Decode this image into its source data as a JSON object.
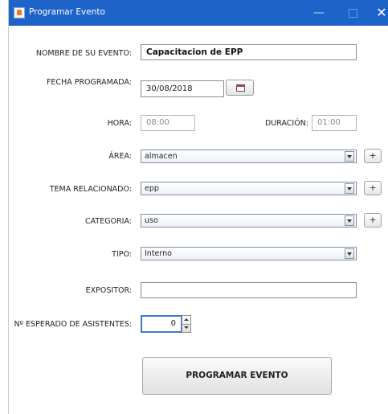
{
  "window": {
    "title": "Programar Evento",
    "minimize_glyph": "—",
    "close_glyph": "✕"
  },
  "form": {
    "nombre_label": "NOMBRE DE SU EVENTO:",
    "nombre_value": "Capacitacion de EPP",
    "fecha_label": "FECHA PROGRAMADA:",
    "fecha_value": "30/08/2018",
    "hora_label": "HORA:",
    "hora_value": "08:00",
    "duracion_label": "DURACIÓN:",
    "duracion_value": "01:00",
    "area_label": "ÁREA:",
    "area_value": "almacen",
    "tema_label": "TEMA RELACIONADO:",
    "tema_value": "epp",
    "categoria_label": "CATEGORIA:",
    "categoria_value": "uso",
    "tipo_label": "TIPO:",
    "tipo_value": "Interno",
    "expositor_label": "EXPOSITOR:",
    "expositor_value": "",
    "asistentes_label": "Nº ESPERADO DE ASISTENTES:",
    "asistentes_value": "0",
    "add_glyph": "+",
    "submit_label": "PROGRAMAR EVENTO"
  },
  "icons": {
    "app": "java-app-icon",
    "calendar": "calendar-icon",
    "dropdown": "chevron-down-icon"
  }
}
